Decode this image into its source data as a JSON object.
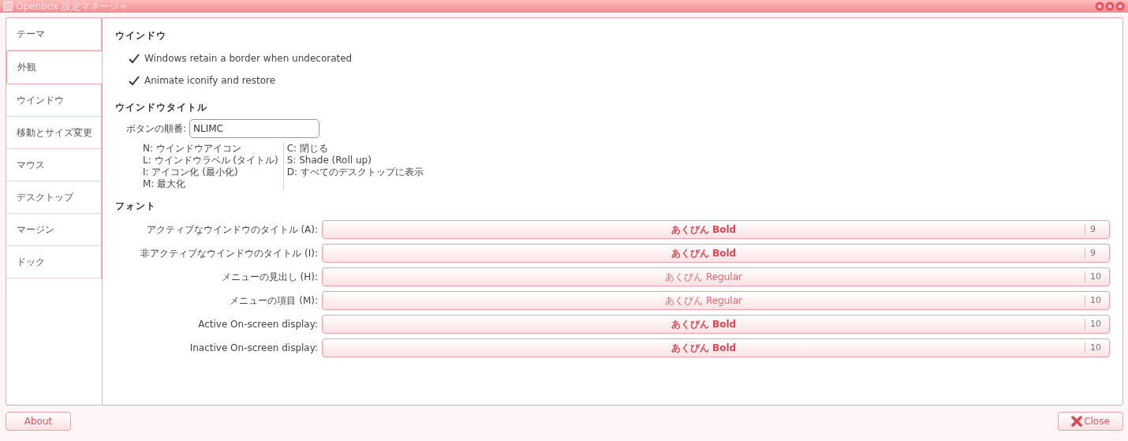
{
  "window": {
    "title": "Openbox 設定マネージャ"
  },
  "tabs": [
    {
      "label": "テーマ",
      "selected": false
    },
    {
      "label": "外観",
      "selected": true
    },
    {
      "label": "ウインドウ",
      "selected": false
    },
    {
      "label": "移動とサイズ変更",
      "selected": false
    },
    {
      "label": "マウス",
      "selected": false
    },
    {
      "label": "デスクトップ",
      "selected": false
    },
    {
      "label": "マージン",
      "selected": false
    },
    {
      "label": "ドック",
      "selected": false
    }
  ],
  "windows_section": {
    "heading": "ウインドウ",
    "options": [
      {
        "label": "Windows retain a border when undecorated",
        "checked": true
      },
      {
        "label": "Animate iconify and restore",
        "checked": true
      }
    ]
  },
  "title_section": {
    "heading": "ウインドウタイトル",
    "button_order_label": "ボタンの順番:",
    "button_order_value": "NLIMC",
    "legend_left": [
      "N: ウインドウアイコン",
      "L: ウインドウラベル (タイトル)",
      "I: アイコン化 (最小化)",
      "M: 最大化"
    ],
    "legend_right": [
      "C: 閉じる",
      "S: Shade (Roll up)",
      "D: すべてのデスクトップに表示"
    ]
  },
  "fonts_section": {
    "heading": "フォント",
    "rows": [
      {
        "label": "アクティブなウインドウのタイトル (A):",
        "font": "あくびん Bold",
        "bold": true,
        "size": "9"
      },
      {
        "label": "非アクティブなウインドウのタイトル (I):",
        "font": "あくびん Bold",
        "bold": true,
        "size": "9"
      },
      {
        "label": "メニューの見出し (H):",
        "font": "あくびん Regular",
        "bold": false,
        "size": "10"
      },
      {
        "label": "メニューの項目 (M):",
        "font": "あくびん Regular",
        "bold": false,
        "size": "10"
      },
      {
        "label": "Active On-screen display:",
        "font": "あくびん Bold",
        "bold": true,
        "size": "10"
      },
      {
        "label": "Inactive On-screen display:",
        "font": "あくびん Bold",
        "bold": true,
        "size": "10"
      }
    ]
  },
  "buttons": {
    "about": "About",
    "close": "Close"
  }
}
